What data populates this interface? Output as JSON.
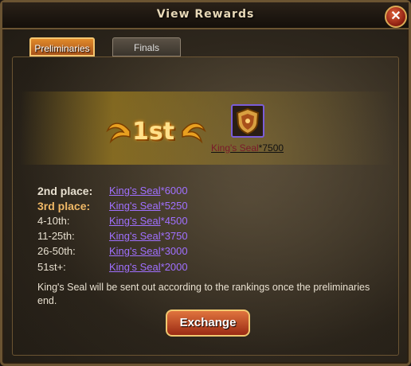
{
  "window": {
    "title": "View Rewards",
    "close_icon": "close-icon"
  },
  "tabs": [
    {
      "label": "Preliminaries",
      "active": true
    },
    {
      "label": "Finals",
      "active": false
    }
  ],
  "first_place": {
    "rank_text": "1st",
    "reward_item": "King's Seal",
    "reward_qty": "*7500",
    "icon": "kings-seal-shield-icon"
  },
  "rewards": [
    {
      "label": "2nd place:",
      "item": "King's Seal",
      "qty": "*6000"
    },
    {
      "label": "3rd place:",
      "item": "King's Seal",
      "qty": "*5250"
    },
    {
      "label": "4-10th:",
      "item": "King's Seal",
      "qty": "*4500"
    },
    {
      "label": "11-25th:",
      "item": "King's Seal",
      "qty": "*3750"
    },
    {
      "label": "26-50th:",
      "item": "King's Seal",
      "qty": "*3000"
    },
    {
      "label": "51st+:",
      "item": "King's Seal",
      "qty": "*2000"
    }
  ],
  "note": "King's Seal will be sent out according to the rankings once the preliminaries end.",
  "exchange_label": "Exchange",
  "colors": {
    "accent": "#e08a2a",
    "link": "#a070ff",
    "frame": "#6b5432"
  }
}
